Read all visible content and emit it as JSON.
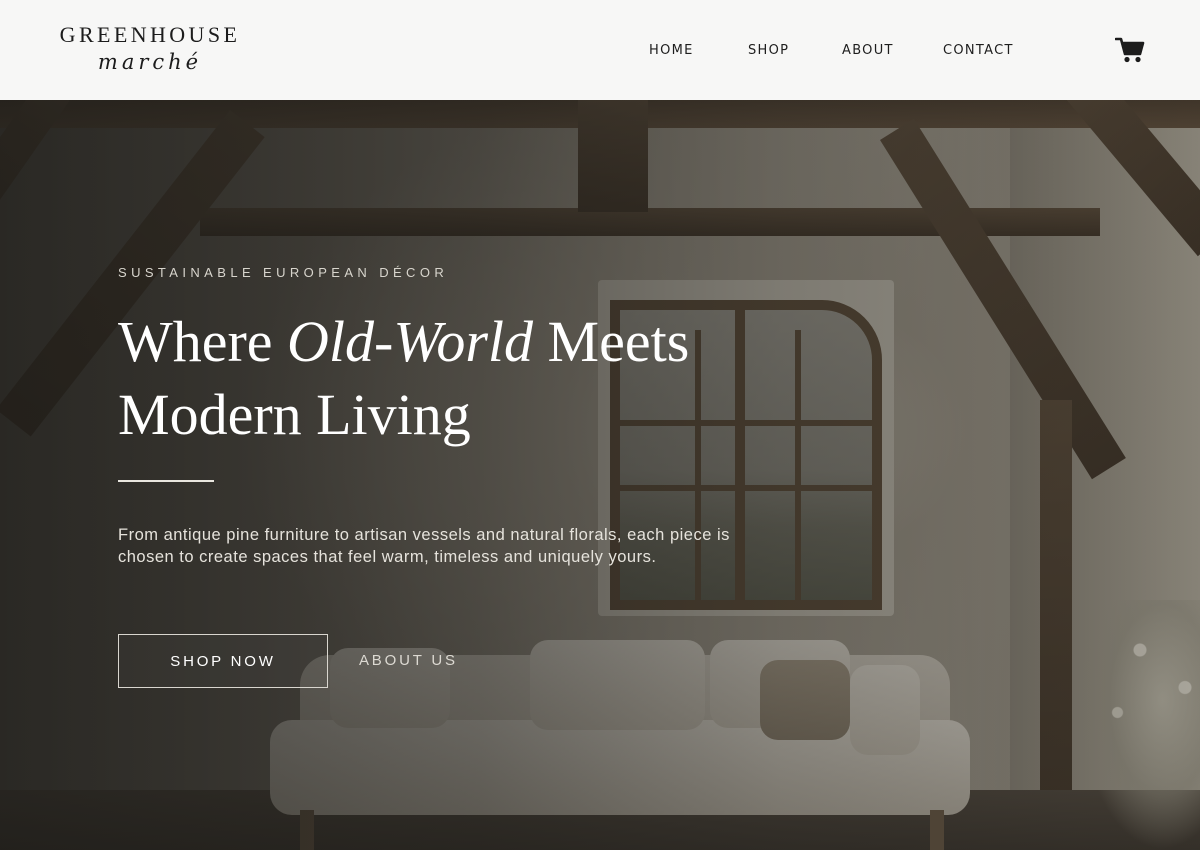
{
  "brand": {
    "logo_line1": "GREENHOUSE",
    "logo_line2": "marché"
  },
  "nav": {
    "items": [
      {
        "label": "HOME"
      },
      {
        "label": "SHOP"
      },
      {
        "label": "ABOUT"
      },
      {
        "label": "CONTACT"
      }
    ],
    "cart_icon": "shopping-cart-icon"
  },
  "hero": {
    "eyebrow": "SUSTAINABLE EUROPEAN DÉCOR",
    "headline": {
      "part1": "Where ",
      "italic": "Old-World",
      "part2": " Meets Modern Living"
    },
    "description": "From antique pine furniture to artisan vessels and natural florals, each piece is chosen to create spaces that feel warm, timeless and uniquely yours.",
    "primary_button": "SHOP NOW",
    "secondary_button": "ABOUT US"
  },
  "colors": {
    "header_bg": "#f7f7f6",
    "text_dark": "#1c1c1c",
    "hero_text": "#ffffff",
    "overlay": "#1c1b18"
  }
}
